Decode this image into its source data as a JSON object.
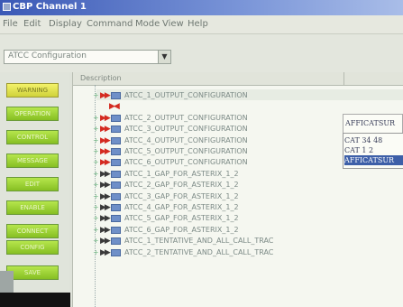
{
  "window": {
    "title": "CBP Channel 1"
  },
  "menu": [
    "File",
    "Edit",
    "Display",
    "Command",
    "Mode",
    "View",
    "Help"
  ],
  "config_select": {
    "value": "ATCC Configuration"
  },
  "side_buttons": [
    {
      "label": "WARNING",
      "active": true
    },
    {
      "label": "OPERATION",
      "active": false
    },
    {
      "label": "CONTROL",
      "active": false
    },
    {
      "label": "MESSAGE",
      "active": false
    },
    {
      "label": "EDIT",
      "active": false
    },
    {
      "label": "ENABLE",
      "active": false
    },
    {
      "label": "CONNECT",
      "active": false
    },
    {
      "label": "CONFIG",
      "active": false
    },
    {
      "label": "SAVE",
      "active": false
    }
  ],
  "tree": {
    "header": "Description",
    "rows": [
      {
        "type": "red",
        "label": "ATCC_1_OUTPUT_CONFIGURATION"
      },
      {
        "type": "red-child",
        "label": ""
      },
      {
        "type": "red",
        "label": "ATCC_2_OUTPUT_CONFIGURATION"
      },
      {
        "type": "red",
        "label": "ATCC_3_OUTPUT_CONFIGURATION"
      },
      {
        "type": "red",
        "label": "ATCC_4_OUTPUT_CONFIGURATION"
      },
      {
        "type": "red",
        "label": "ATCC_5_OUTPUT_CONFIGURATION"
      },
      {
        "type": "red",
        "label": "ATCC_6_OUTPUT_CONFIGURATION"
      },
      {
        "type": "black",
        "label": "ATCC_1_GAP_FOR_ASTERIX_1_2"
      },
      {
        "type": "black",
        "label": "ATCC_2_GAP_FOR_ASTERIX_1_2"
      },
      {
        "type": "black",
        "label": "ATCC_3_GAP_FOR_ASTERIX_1_2"
      },
      {
        "type": "black",
        "label": "ATCC_4_GAP_FOR_ASTERIX_1_2"
      },
      {
        "type": "black",
        "label": "ATCC_5_GAP_FOR_ASTERIX_1_2"
      },
      {
        "type": "black",
        "label": "ATCC_6_GAP_FOR_ASTERIX_1_2"
      },
      {
        "type": "black",
        "label": "ATCC_1_TENTATIVE_AND_ALL_CALL_TRAC"
      },
      {
        "type": "black",
        "label": "ATCC_2_TENTATIVE_AND_ALL_CALL_TRAC"
      }
    ]
  },
  "value_box": "AFFICATSUR",
  "dropdown": {
    "options": [
      "CAT 34 48",
      "CAT 1 2",
      "AFFICATSUR"
    ],
    "selected_index": 2
  }
}
